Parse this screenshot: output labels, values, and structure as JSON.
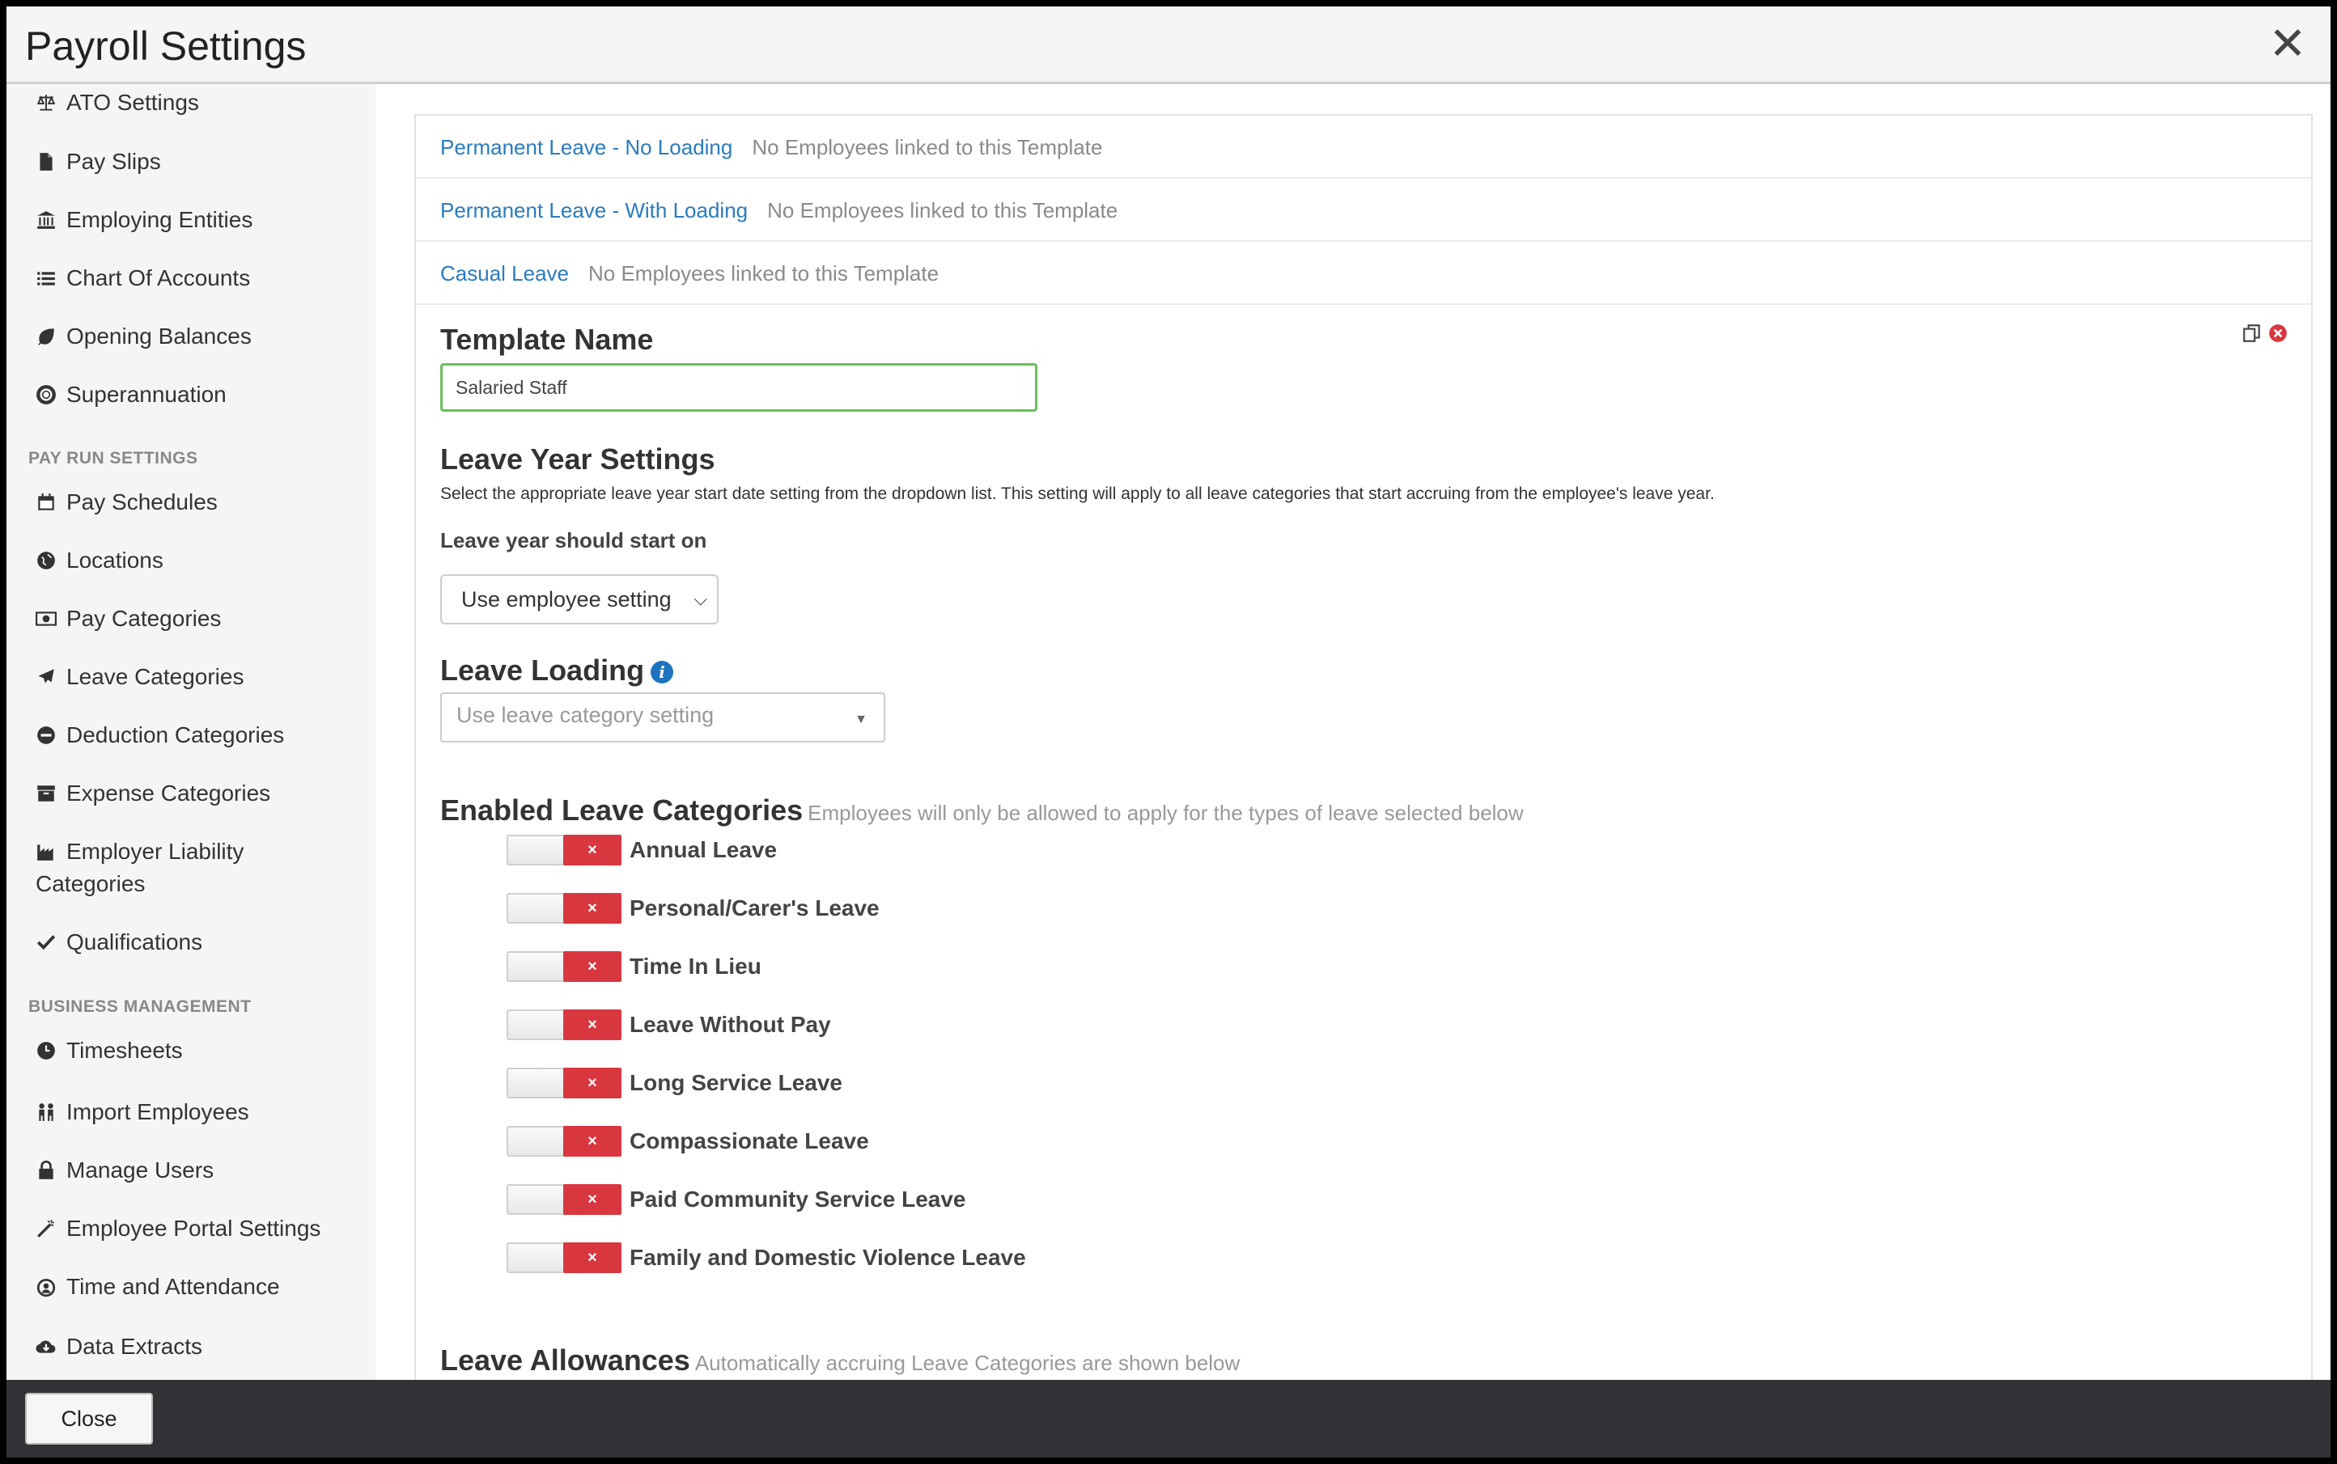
{
  "header": {
    "title": "Payroll Settings",
    "close_glyph": "✕"
  },
  "sidebar": {
    "top_items": [
      {
        "label": "ATO Settings",
        "icon": "scale-icon"
      },
      {
        "label": "Pay Slips",
        "icon": "file-icon"
      },
      {
        "label": "Employing Entities",
        "icon": "bank-icon"
      },
      {
        "label": "Chart Of Accounts",
        "icon": "list-icon"
      },
      {
        "label": "Opening Balances",
        "icon": "leaf-icon"
      },
      {
        "label": "Superannuation",
        "icon": "lifebuoy-icon"
      }
    ],
    "pay_run_header": "PAY RUN SETTINGS",
    "pay_run_items": [
      {
        "label": "Pay Schedules",
        "icon": "calendar-icon"
      },
      {
        "label": "Locations",
        "icon": "globe-icon"
      },
      {
        "label": "Pay Categories",
        "icon": "money-icon"
      },
      {
        "label": "Leave Categories",
        "icon": "plane-icon"
      },
      {
        "label": "Deduction Categories",
        "icon": "minus-circle-icon"
      },
      {
        "label": "Expense Categories",
        "icon": "archive-icon"
      },
      {
        "label": "Employer Liability Categories",
        "icon": "industry-icon"
      },
      {
        "label": "Qualifications",
        "icon": "check-icon"
      }
    ],
    "business_header": "BUSINESS MANAGEMENT",
    "business_items": [
      {
        "label": "Timesheets",
        "icon": "clock-icon"
      },
      {
        "label": "Import Employees",
        "icon": "users-icon"
      },
      {
        "label": "Manage Users",
        "icon": "lock-icon"
      },
      {
        "label": "Employee Portal Settings",
        "icon": "wand-icon"
      },
      {
        "label": "Time and Attendance",
        "icon": "attendance-icon"
      },
      {
        "label": "Data Extracts",
        "icon": "cloud-download-icon"
      }
    ]
  },
  "templates": [
    {
      "name": "Permanent Leave - No Loading",
      "note": "No Employees linked to this Template"
    },
    {
      "name": "Permanent Leave - With Loading",
      "note": "No Employees linked to this Template"
    },
    {
      "name": "Casual Leave",
      "note": "No Employees linked to this Template"
    }
  ],
  "form": {
    "template_name_label": "Template Name",
    "template_name_value": "Salaried Staff",
    "leave_year_title": "Leave Year Settings",
    "leave_year_desc": "Select the appropriate leave year start date setting from the dropdown list. This setting will apply to all leave categories that start accruing from the employee's leave year.",
    "leave_year_start_label": "Leave year should start on",
    "leave_year_start_value": "Use employee setting",
    "leave_loading_title": "Leave Loading",
    "leave_loading_placeholder": "Use leave category setting",
    "enabled_title": "Enabled Leave Categories",
    "enabled_sub": "Employees will only be allowed to apply for the types of leave selected below",
    "categories": [
      {
        "label": "Annual Leave",
        "enabled": false
      },
      {
        "label": "Personal/Carer's Leave",
        "enabled": false
      },
      {
        "label": "Time In Lieu",
        "enabled": false
      },
      {
        "label": "Leave Without Pay",
        "enabled": false
      },
      {
        "label": "Long Service Leave",
        "enabled": false
      },
      {
        "label": "Compassionate Leave",
        "enabled": false
      },
      {
        "label": "Paid Community Service Leave",
        "enabled": false
      },
      {
        "label": "Family and Domestic Violence Leave",
        "enabled": false
      }
    ],
    "toggle_off_glyph": "×",
    "allowances_title": "Leave Allowances",
    "allowances_sub": "Automatically accruing Leave Categories are shown below"
  },
  "footer": {
    "close_label": "Close"
  },
  "colors": {
    "link": "#2a7bbf",
    "toggle_off": "#d9373f",
    "footer": "#303236",
    "input_focus": "#6abf5c"
  }
}
